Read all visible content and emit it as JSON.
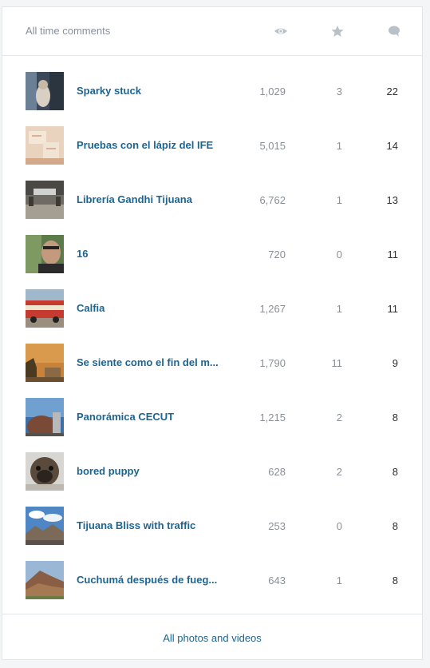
{
  "header": {
    "title": "All time comments",
    "icons": [
      "views-eye-icon",
      "favorites-star-icon",
      "comments-bubble-icon"
    ]
  },
  "colors": {
    "link": "#1c6592",
    "muted": "#8a8f96",
    "icon": "#b9c0c6",
    "border": "#e3e6e8"
  },
  "photos": [
    {
      "title": "Sparky stuck",
      "views": "1,029",
      "favs": "3",
      "comments": "22"
    },
    {
      "title": "Pruebas con el lápiz del IFE",
      "views": "5,015",
      "favs": "1",
      "comments": "14"
    },
    {
      "title": "Librería Gandhi Tijuana",
      "views": "6,762",
      "favs": "1",
      "comments": "13"
    },
    {
      "title": "16",
      "views": "720",
      "favs": "0",
      "comments": "11"
    },
    {
      "title": "Calfia",
      "views": "1,267",
      "favs": "1",
      "comments": "11"
    },
    {
      "title": "Se siente como el fin del m...",
      "views": "1,790",
      "favs": "11",
      "comments": "9"
    },
    {
      "title": "Panorámica CECUT",
      "views": "1,215",
      "favs": "2",
      "comments": "8"
    },
    {
      "title": "bored puppy",
      "views": "628",
      "favs": "2",
      "comments": "8"
    },
    {
      "title": "Tijuana Bliss with traffic",
      "views": "253",
      "favs": "0",
      "comments": "8"
    },
    {
      "title": "Cuchumá después de fueg...",
      "views": "643",
      "favs": "1",
      "comments": "8"
    }
  ],
  "footer": {
    "link_label": "All photos and videos"
  }
}
